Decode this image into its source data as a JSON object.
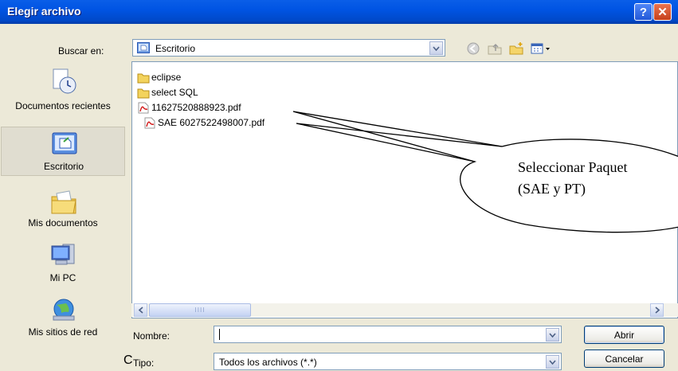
{
  "window": {
    "title": "Elegir archivo"
  },
  "titlebar": {
    "help_label": "?",
    "close_label": "✕"
  },
  "lookin": {
    "label": "Buscar en:",
    "value": "Escritorio"
  },
  "toolbar": {
    "icons": [
      "back-icon",
      "up-folder-icon",
      "new-folder-icon",
      "view-menu-icon"
    ]
  },
  "places": [
    {
      "label": "Documentos recientes",
      "icon": "recent-documents-icon"
    },
    {
      "label": "Escritorio",
      "icon": "desktop-icon"
    },
    {
      "label": "Mis documentos",
      "icon": "my-documents-icon"
    },
    {
      "label": "Mi PC",
      "icon": "my-computer-icon"
    },
    {
      "label": "Mis sitios de red",
      "icon": "network-places-icon"
    }
  ],
  "files": [
    {
      "name": "eclipse",
      "type": "folder"
    },
    {
      "name": "select SQL",
      "type": "folder"
    },
    {
      "name": "11627520888923.pdf",
      "type": "pdf"
    },
    {
      "name": "SAE 6027522498007.pdf",
      "type": "pdf"
    }
  ],
  "scrollbar": {
    "thumb_grip": "IIII"
  },
  "filename": {
    "label": "Nombre:",
    "value": ""
  },
  "filetype": {
    "label": "Tipo:",
    "value": "Todos los archivos (*.*)"
  },
  "buttons": {
    "open": "Abrir",
    "cancel": "Cancelar"
  },
  "callout": {
    "line1": "Seleccionar Paquet",
    "line2": "(SAE y PT)"
  },
  "outside_text": "C",
  "colors": {
    "titlebar": "#0054e3",
    "dialog": "#ece9d8",
    "border": "#7f9db9"
  }
}
